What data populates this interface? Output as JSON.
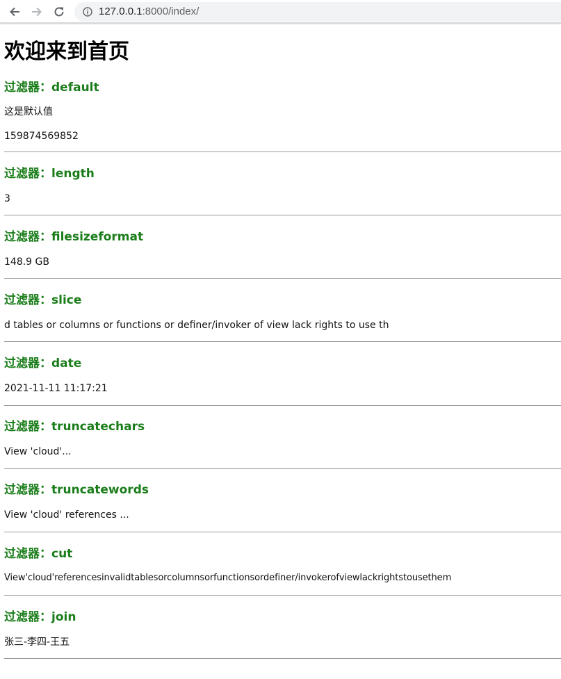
{
  "browser": {
    "url_host": "127.0.0.1",
    "url_path": ":8000/index/"
  },
  "page": {
    "title": "欢迎来到首页"
  },
  "sections": [
    {
      "heading": "过滤器：default",
      "lines": [
        "这是默认值",
        "159874569852"
      ]
    },
    {
      "heading": "过滤器：length",
      "lines": [
        "3"
      ]
    },
    {
      "heading": "过滤器：filesizeformat",
      "lines": [
        "148.9 GB"
      ]
    },
    {
      "heading": "过滤器：slice",
      "lines": [
        "d tables or columns or functions or definer/invoker of view lack rights to use th"
      ]
    },
    {
      "heading": "过滤器：date",
      "lines": [
        "2021-11-11 11:17:21"
      ]
    },
    {
      "heading": "过滤器：truncatechars",
      "lines": [
        "View 'cloud'..."
      ]
    },
    {
      "heading": "过滤器：truncatewords",
      "lines": [
        "View 'cloud' references ..."
      ]
    },
    {
      "heading": "过滤器：cut",
      "lines": [
        "View'cloud'referencesinvalidtablesorcolumnsorfunctionsordefiner/invokerofviewlackrightstousethem"
      ]
    },
    {
      "heading": "过滤器：join",
      "lines": [
        "张三-李四-王五"
      ]
    }
  ]
}
